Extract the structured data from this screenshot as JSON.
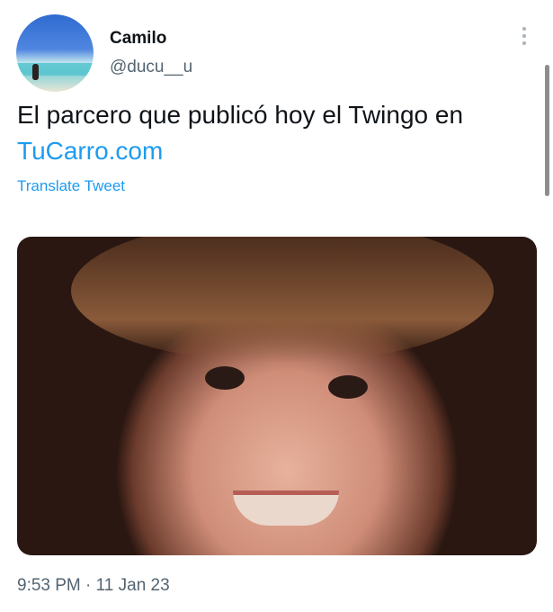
{
  "tweet": {
    "author": {
      "name": "Camilo",
      "handle": "@ducu__u"
    },
    "text": "El parcero que publicó hoy el Twingo en",
    "link": "TuCarro.com",
    "translate": "Translate Tweet",
    "timestamp": "9:53 PM · 11 Jan 23",
    "media_alt": "Photo of a smiling girl with bangs"
  },
  "icons": [
    "more-icon"
  ]
}
